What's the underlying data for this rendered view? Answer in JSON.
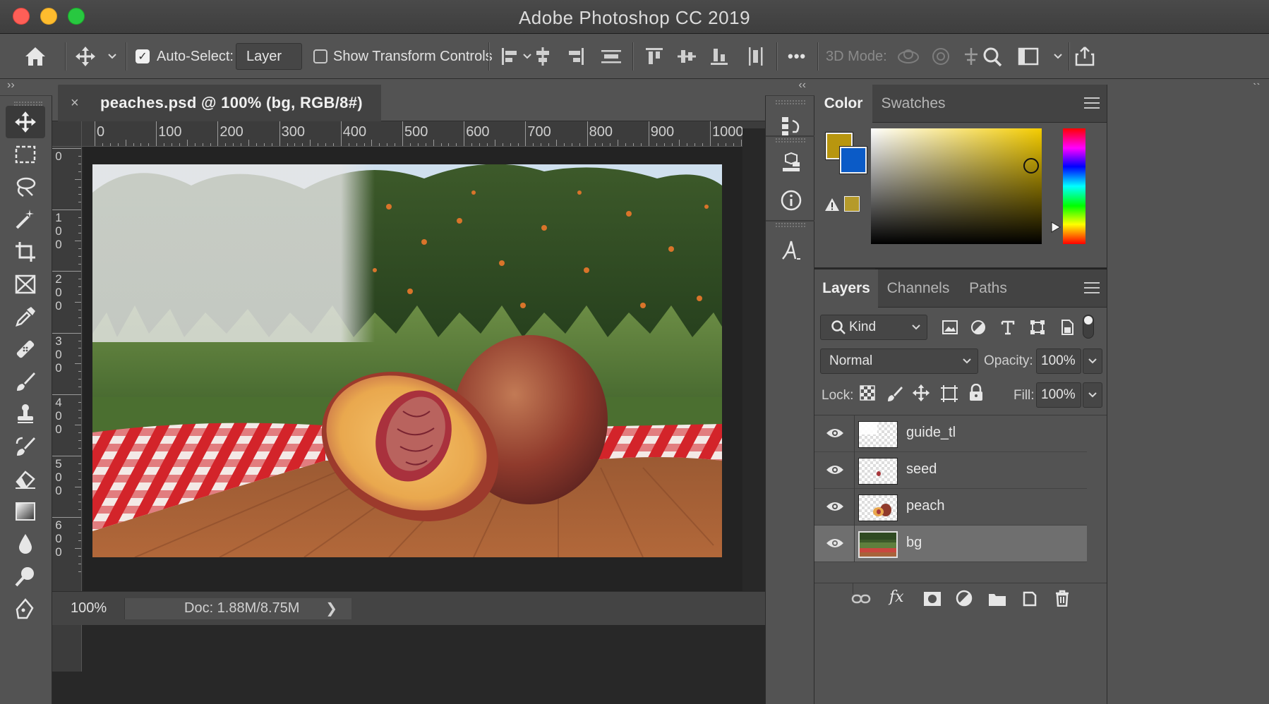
{
  "window": {
    "title": "Adobe Photoshop CC 2019"
  },
  "options_bar": {
    "auto_select_label": "Auto-Select:",
    "auto_select_checked": true,
    "auto_select_target": "Layer",
    "show_transform_label": "Show Transform Controls",
    "show_transform_checked": false,
    "more_label": "•••",
    "mode_3d_label": "3D Mode:"
  },
  "document": {
    "tab_label": "peaches.psd @ 100% (bg, RGB/8#)",
    "close_glyph": "×",
    "zoom": "100%",
    "doc_info": "Doc: 1.88M/8.75M",
    "status_arrow": "❯"
  },
  "rulers": {
    "horizontal": [
      "0",
      "100",
      "200",
      "300",
      "400",
      "500",
      "600",
      "700",
      "800",
      "900",
      "1000"
    ],
    "vertical": [
      "0",
      "100",
      "200",
      "300",
      "400",
      "500",
      "600"
    ]
  },
  "collapse_glyphs": {
    "left": "››",
    "mini": "‹‹",
    "right": "››"
  },
  "color_panel": {
    "tabs": [
      "Color",
      "Swatches"
    ],
    "active_tab": "Color",
    "foreground": "#b8960f",
    "background": "#0b5bc7",
    "gamut_warning_swatch": "#b59a2a",
    "field_hue": "#f4cc00"
  },
  "layers_panel": {
    "tabs": [
      "Layers",
      "Channels",
      "Paths"
    ],
    "active_tab": "Layers",
    "filter_label": "Kind",
    "blend_mode": "Normal",
    "opacity_label": "Opacity:",
    "opacity_value": "100%",
    "lock_label": "Lock:",
    "fill_label": "Fill:",
    "fill_value": "100%",
    "layers": [
      {
        "name": "guide_tl",
        "visible": true,
        "selected": false
      },
      {
        "name": "seed",
        "visible": true,
        "selected": false
      },
      {
        "name": "peach",
        "visible": true,
        "selected": false
      },
      {
        "name": "bg",
        "visible": true,
        "selected": true
      }
    ],
    "footer_fx": "fx"
  }
}
